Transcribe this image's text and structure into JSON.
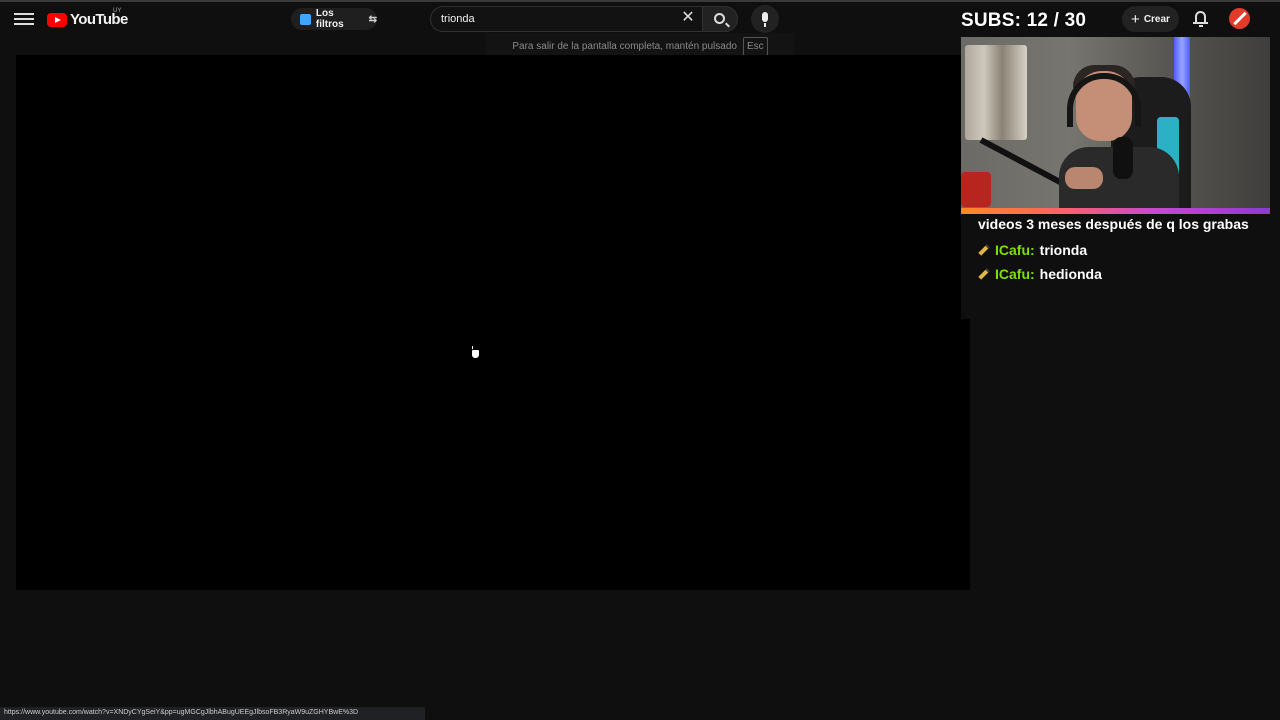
{
  "header": {
    "logo_text": "YouTube",
    "country_code": "UY",
    "filters_label": "Los filtros",
    "search_value": "trionda",
    "create_label": "Crear",
    "icons": [
      "menu-icon",
      "youtube-logo-icon",
      "filter-sliders-icon",
      "clear-icon",
      "search-icon",
      "mic-icon",
      "plus-icon",
      "bell-icon",
      "avatar"
    ]
  },
  "fullscreen_toast": {
    "text": "Para salir de la pantalla completa, mantén pulsado",
    "key": "Esc"
  },
  "overlay": {
    "subs_label": "SUBS:",
    "subs_current": "12",
    "subs_separator": "/",
    "subs_goal": "30",
    "subs_display": "SUBS: 12 / 30"
  },
  "chat": {
    "continued_text": "videos 3 meses después de q los grabas",
    "messages": [
      {
        "user": "ICafu:",
        "text": "trionda"
      },
      {
        "user": "ICafu:",
        "text": "hedionda"
      }
    ]
  },
  "status_bar": {
    "url": "https://www.youtube.com/watch?v=XNDyCYgSeiY&pp=ugMGCgJlbhABugUEEgJlbsoFB3RyaW9uZGHYBwE%3D"
  },
  "colors": {
    "background": "#0f0f0f",
    "player": "#000000",
    "chat_user": "#7fe000",
    "brand_red": "#ff0000"
  }
}
